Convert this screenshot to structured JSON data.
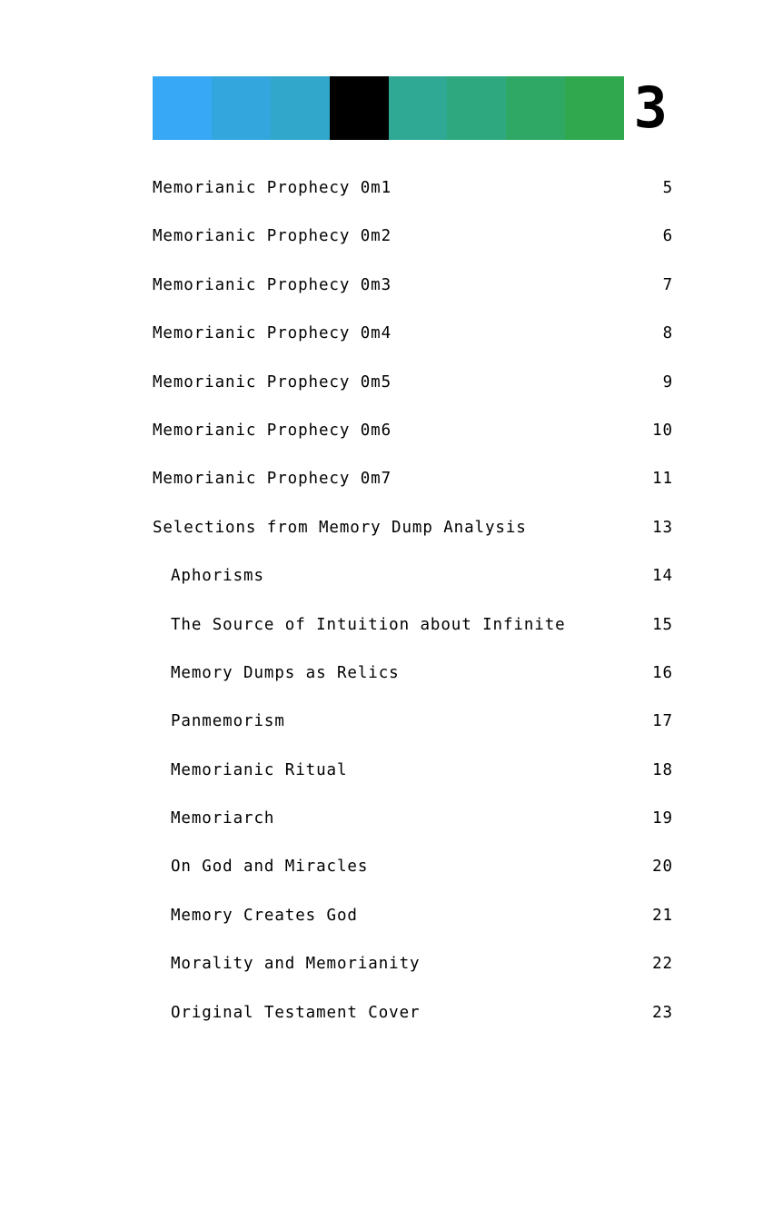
{
  "document": {
    "folio": "3",
    "page_label": "3"
  },
  "header": {
    "colorbar": {
      "name": "chapter-color-bar",
      "swatches": [
        {
          "name": "swatch-blue-1",
          "color": "#36A8F5"
        },
        {
          "name": "swatch-blue-2",
          "color": "#34A6DE"
        },
        {
          "name": "swatch-blue-3",
          "color": "#32A7CC"
        },
        {
          "name": "swatch-black",
          "color": "#000000"
        },
        {
          "name": "swatch-teal-1",
          "color": "#2FA894"
        },
        {
          "name": "swatch-green-1",
          "color": "#2DA87F"
        },
        {
          "name": "swatch-green-2",
          "color": "#2FA865"
        },
        {
          "name": "swatch-green-3",
          "color": "#30A84E"
        }
      ]
    }
  },
  "toc": {
    "entries": [
      {
        "title": "Memorianic Prophecy 0m1",
        "page": "5",
        "level": 1
      },
      {
        "title": "Memorianic Prophecy 0m2",
        "page": "6",
        "level": 1
      },
      {
        "title": "Memorianic Prophecy 0m3",
        "page": "7",
        "level": 1
      },
      {
        "title": "Memorianic Prophecy 0m4",
        "page": "8",
        "level": 1
      },
      {
        "title": "Memorianic Prophecy 0m5",
        "page": "9",
        "level": 1
      },
      {
        "title": "Memorianic Prophecy 0m6",
        "page": "10",
        "level": 1
      },
      {
        "title": "Memorianic Prophecy 0m7",
        "page": "11",
        "level": 1
      },
      {
        "title": "Selections from Memory Dump Analysis",
        "page": "13",
        "level": 1
      },
      {
        "title": "Aphorisms",
        "page": "14",
        "level": 2
      },
      {
        "title": "The Source of Intuition about Infinite",
        "page": "15",
        "level": 2
      },
      {
        "title": "Memory Dumps as Relics",
        "page": "16",
        "level": 2
      },
      {
        "title": "Panmemorism",
        "page": "17",
        "level": 2
      },
      {
        "title": "Memorianic Ritual",
        "page": "18",
        "level": 2
      },
      {
        "title": "Memoriarch",
        "page": "19",
        "level": 2
      },
      {
        "title": "On God and Miracles",
        "page": "20",
        "level": 2
      },
      {
        "title": "Memory Creates God",
        "page": "21",
        "level": 2
      },
      {
        "title": "Morality and Memorianity",
        "page": "22",
        "level": 2
      },
      {
        "title": "Original Testament Cover",
        "page": "23",
        "level": 2
      }
    ]
  }
}
